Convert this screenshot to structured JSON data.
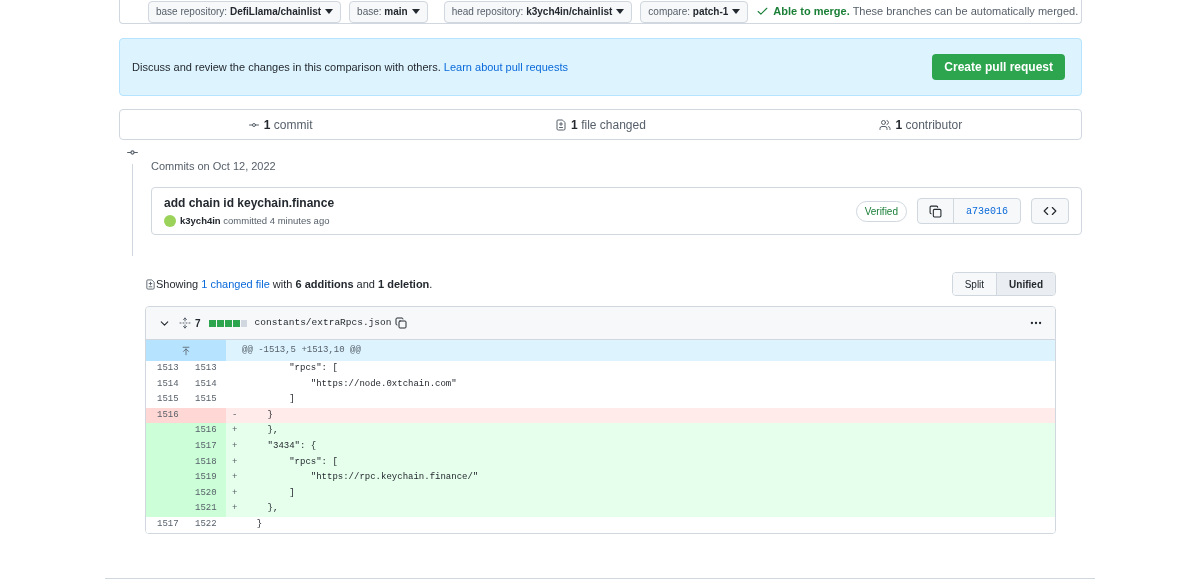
{
  "compare_bar": {
    "base_repository": {
      "label": "base repository:",
      "value": "DefiLlama/chainlist"
    },
    "base": {
      "label": "base:",
      "value": "main"
    },
    "head_repository": {
      "label": "head repository:",
      "value": "k3ych4in/chainlist"
    },
    "compare": {
      "label": "compare:",
      "value": "patch-1"
    },
    "merge_status": {
      "title": "Able to merge.",
      "text": "These branches can be automatically merged."
    }
  },
  "banner": {
    "text": "Discuss and review the changes in this comparison with others.",
    "link": "Learn about pull requests",
    "button": "Create pull request"
  },
  "summary": [
    {
      "kind": "commit",
      "count": "1",
      "label": "commit"
    },
    {
      "kind": "file",
      "count": "1",
      "label": "file changed"
    },
    {
      "kind": "contributor",
      "count": "1",
      "label": "contributor"
    }
  ],
  "commits_heading": "Commits on Oct 12, 2022",
  "commit": {
    "title": "add chain id keychain.finance",
    "author": "k3ych4in",
    "meta": "committed 4 minutes ago",
    "badge": "Verified",
    "sha": "a73e016"
  },
  "showing": {
    "text": "Showing",
    "link": "1 changed file",
    "rest": "with **6 additions** and **1 deletion**."
  },
  "view_modes": [
    {
      "label": "Split",
      "selected": false
    },
    {
      "label": "Unified",
      "selected": true
    }
  ],
  "file": {
    "count": "7",
    "path": "constants/extraRpcs.json",
    "hunk": "@@ -1513,5 +1513,10 @@",
    "lines": [
      {
        "kind": "context",
        "old": "1513",
        "new": "1513",
        "code": "        \"rpcs\": ["
      },
      {
        "kind": "context",
        "old": "1514",
        "new": "1514",
        "code": "            \"https://node.0xtchain.com\""
      },
      {
        "kind": "context",
        "old": "1515",
        "new": "1515",
        "code": "        ]"
      },
      {
        "kind": "del",
        "old": "1516",
        "sign": "-",
        "code": "    }"
      },
      {
        "kind": "add",
        "new": "1516",
        "sign": "+",
        "code": "    },"
      },
      {
        "kind": "add",
        "new": "1517",
        "sign": "+",
        "code": "    \"3434\": {"
      },
      {
        "kind": "add",
        "new": "1518",
        "sign": "+",
        "code": "        \"rpcs\": ["
      },
      {
        "kind": "add",
        "new": "1519",
        "sign": "+",
        "code": "            \"https://rpc.keychain.finance/\""
      },
      {
        "kind": "add",
        "new": "1520",
        "sign": "+",
        "code": "        ]"
      },
      {
        "kind": "add",
        "new": "1521",
        "sign": "+",
        "code": "    },"
      },
      {
        "kind": "context",
        "old": "1517",
        "new": "1522",
        "code": "  }"
      }
    ]
  }
}
